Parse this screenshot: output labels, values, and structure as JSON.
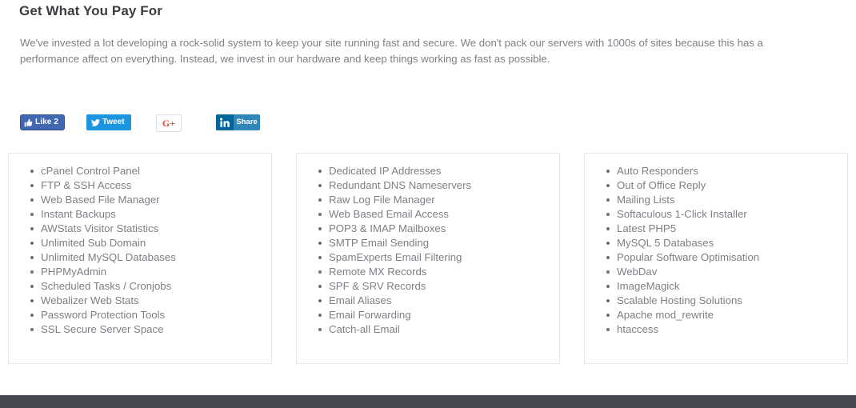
{
  "page": {
    "heading": "Get What You Pay For",
    "paragraph": "We've invested a lot developing a rock-solid system to keep your site running fast and secure. We don't pack our servers with 1000s of sites because this has a performance affect on everything. Instead, we invest in our hardware and keep things working as fast as possible."
  },
  "social": {
    "facebook": {
      "label": "Like",
      "count": "2",
      "icon": "thumbs-up-icon",
      "bg_color": "#4267b2"
    },
    "twitter": {
      "label": "Tweet",
      "icon": "twitter-bird-icon",
      "bg_color": "#1b95e0"
    },
    "googleplus": {
      "label": "G+",
      "icon": "google-plus-icon",
      "bg_color": "#ffffff",
      "text_color": "#dd4b39"
    },
    "linkedin": {
      "mark": "in",
      "label": "Share",
      "icon": "linkedin-icon",
      "bg_color": "#0e76a8"
    }
  },
  "cards": [
    {
      "items": [
        "cPanel Control Panel",
        "FTP & SSH Access",
        "Web Based File Manager",
        "Instant Backups",
        "AWStats Visitor Statistics",
        "Unlimited Sub Domain",
        "Unlimited MySQL Databases",
        "PHPMyAdmin",
        "Scheduled Tasks / Cronjobs",
        "Webalizer Web Stats",
        "Password Protection Tools",
        "SSL Secure Server Space"
      ]
    },
    {
      "items": [
        "Dedicated IP Addresses",
        "Redundant DNS Nameservers",
        "Raw Log File Manager",
        "Web Based Email Access",
        "POP3 & IMAP Mailboxes",
        "SMTP Email Sending",
        "SpamExperts Email Filtering",
        "Remote MX Records",
        "SPF & SRV Records",
        "Email Aliases",
        "Email Forwarding",
        "Catch-all Email"
      ]
    },
    {
      "items": [
        "Auto Responders",
        "Out of Office Reply",
        "Mailing Lists",
        "Softaculous 1-Click Installer",
        "Latest PHP5",
        "MySQL 5 Databases",
        "Popular Software Optimisation",
        "WebDav",
        "ImageMagick",
        "Scalable Hosting Solutions",
        "Apache mod_rewrite",
        "htaccess"
      ]
    }
  ],
  "colors": {
    "heading": "#3a3c40",
    "body_text": "#7c7f84",
    "card_border": "#e8e8e8",
    "footer_bar": "#45474f"
  }
}
